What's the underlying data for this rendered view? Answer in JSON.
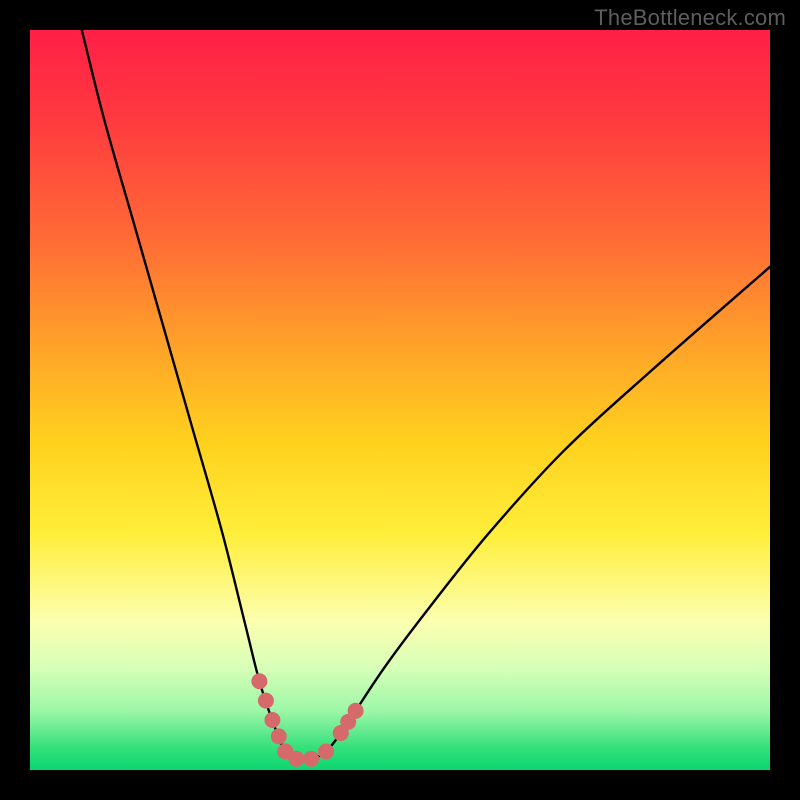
{
  "watermark": "TheBottleneck.com",
  "chart_data": {
    "type": "line",
    "title": "",
    "xlabel": "",
    "ylabel": "",
    "xlim": [
      0,
      100
    ],
    "ylim": [
      0,
      100
    ],
    "series": [
      {
        "name": "bottleneck-curve",
        "x": [
          7,
          10,
          14,
          18,
          22,
          26,
          29,
          31,
          33,
          34.5,
          36,
          38,
          40,
          42,
          44,
          48,
          54,
          62,
          72,
          84,
          100
        ],
        "values": [
          100,
          88,
          74,
          60,
          46,
          32,
          20,
          12,
          6,
          2.5,
          1.5,
          1.5,
          2.5,
          5,
          8,
          14,
          22,
          32,
          43,
          54,
          68
        ]
      }
    ],
    "highlight_segments": [
      {
        "name": "left-red-dots",
        "x_range": [
          31,
          34.5
        ]
      },
      {
        "name": "right-red-dots",
        "x_range": [
          42,
          44
        ]
      }
    ],
    "bottom_dots": {
      "x": [
        34.5,
        36,
        38,
        40,
        42
      ],
      "values": [
        2.5,
        1.5,
        1.5,
        2.5,
        5
      ]
    },
    "colors": {
      "curve": "#000000",
      "highlight": "#d66a6a",
      "gradient_top": "#ff1f47",
      "gradient_bottom": "#0bd670"
    }
  }
}
